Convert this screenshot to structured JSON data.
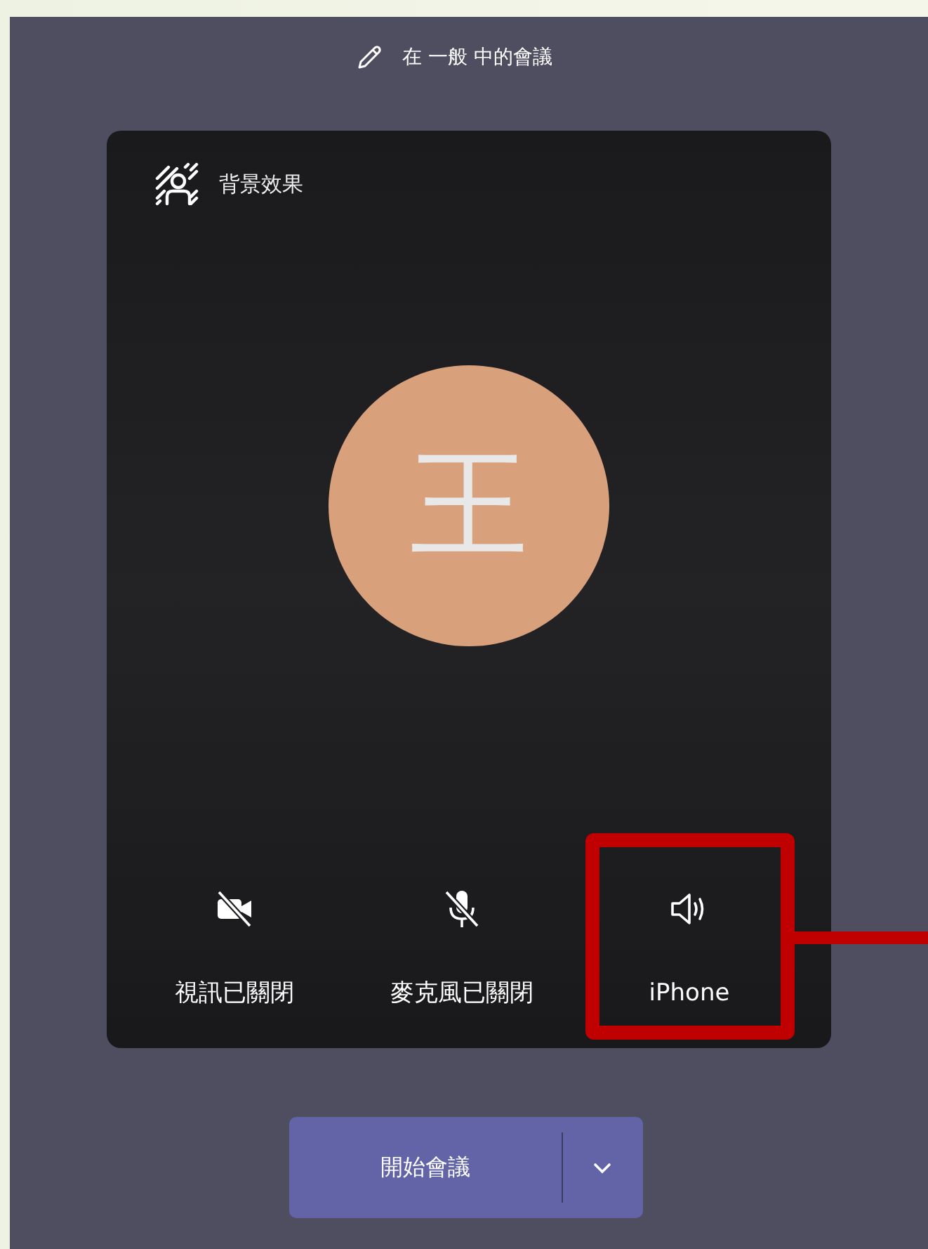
{
  "meeting_title": "在 一般 中的會議",
  "background_effects": {
    "label": "背景效果"
  },
  "avatar": {
    "initial": "王"
  },
  "controls": [
    {
      "kind": "video",
      "label": "視訊已關閉",
      "off": true,
      "highlighted": false
    },
    {
      "kind": "mic",
      "label": "麥克風已關閉",
      "off": true,
      "highlighted": false
    },
    {
      "kind": "speaker",
      "label": "iPhone",
      "off": false,
      "highlighted": true
    }
  ],
  "start_button": {
    "label": "開始會議"
  }
}
